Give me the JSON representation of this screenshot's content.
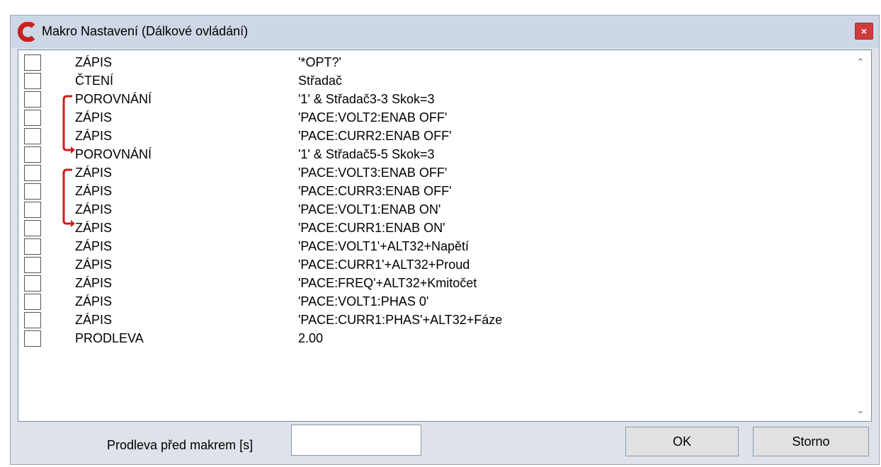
{
  "window": {
    "title": "Makro Nastavení (Dálkové ovládání)",
    "close_label": "×"
  },
  "brand_color": "#cc1f1f",
  "rows": [
    {
      "command": "ZÁPIS",
      "argument": "'*OPT?'"
    },
    {
      "command": "ČTENÍ",
      "argument": "Střadač"
    },
    {
      "command": "POROVNÁNÍ",
      "argument": "'1' & Střadač3-3 Skok=3"
    },
    {
      "command": "ZÁPIS",
      "argument": "'PACE:VOLT2:ENAB OFF'"
    },
    {
      "command": "ZÁPIS",
      "argument": "'PACE:CURR2:ENAB OFF'"
    },
    {
      "command": "POROVNÁNÍ",
      "argument": "'1' & Střadač5-5 Skok=3"
    },
    {
      "command": "ZÁPIS",
      "argument": "'PACE:VOLT3:ENAB OFF'"
    },
    {
      "command": "ZÁPIS",
      "argument": "'PACE:CURR3:ENAB OFF'"
    },
    {
      "command": "ZÁPIS",
      "argument": "'PACE:VOLT1:ENAB ON'"
    },
    {
      "command": "ZÁPIS",
      "argument": "'PACE:CURR1:ENAB ON'"
    },
    {
      "command": "ZÁPIS",
      "argument": "'PACE:VOLT1'+ALT32+Napětí"
    },
    {
      "command": "ZÁPIS",
      "argument": "'PACE:CURR1'+ALT32+Proud"
    },
    {
      "command": "ZÁPIS",
      "argument": "'PACE:FREQ'+ALT32+Kmitočet"
    },
    {
      "command": "ZÁPIS",
      "argument": "'PACE:VOLT1:PHAS 0'"
    },
    {
      "command": "ZÁPIS",
      "argument": "'PACE:CURR1:PHAS'+ALT32+Fáze"
    },
    {
      "command": "PRODLEVA",
      "argument": "2.00"
    }
  ],
  "footer": {
    "delay_label": "Prodleva před makrem [s]",
    "delay_value": "",
    "ok_label": "OK",
    "cancel_label": "Storno"
  }
}
